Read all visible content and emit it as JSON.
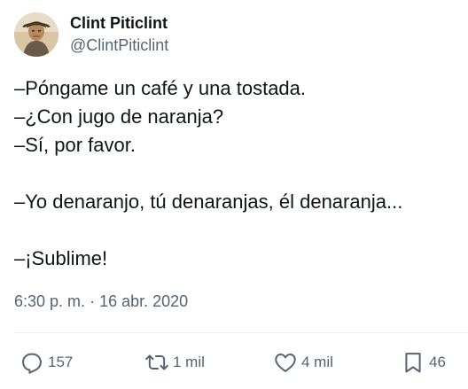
{
  "author": {
    "name": "Clint Piticlint",
    "handle": "@ClintPiticlint",
    "avatar_icon": "profile-photo"
  },
  "tweet": {
    "lines": [
      "–Póngame un café y una tostada.",
      "–¿Con jugo de naranja?",
      "–Sí, por favor.",
      "",
      "–Yo denaranjo, tú denaranjas, él denaranja...",
      "",
      "–¡Sublime!"
    ],
    "time": "6:30 p. m.",
    "separator": "·",
    "date": "16 abr. 2020"
  },
  "actions": {
    "replies": "157",
    "retweets": "1 mil",
    "likes": "4 mil",
    "bookmarks": "46"
  },
  "colors": {
    "text": "#0f1419",
    "secondary": "#536471",
    "divider": "#eff3f4"
  }
}
